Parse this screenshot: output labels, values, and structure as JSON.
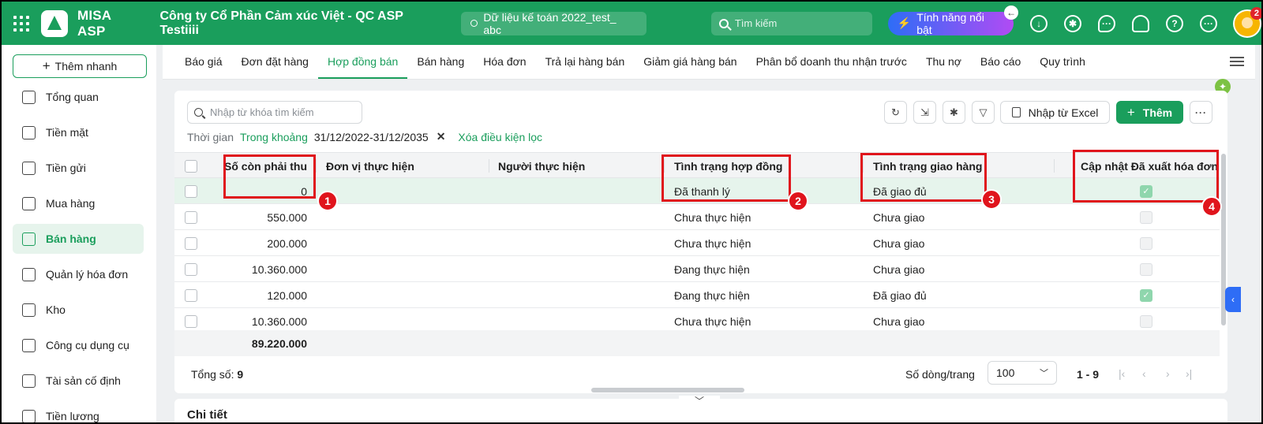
{
  "app": {
    "brand": "MISA ASP",
    "company": "Công ty Cổ Phần Cảm xúc Việt - QC ASP Testiiii",
    "database": "Dữ liệu kế toán 2022_test_ abc",
    "search_placeholder": "Tìm kiếm",
    "feature_label": "Tính năng nổi bật",
    "notification_count": "2",
    "top_icons": [
      "download-icon",
      "gear-icon",
      "chat-icon",
      "bell-icon",
      "help-icon",
      "more-horizontal-icon"
    ]
  },
  "sidebar": {
    "quick_add": "Thêm nhanh",
    "items": [
      {
        "label": "Tổng quan",
        "icon": "dashboard-icon"
      },
      {
        "label": "Tiền mặt",
        "icon": "cash-icon"
      },
      {
        "label": "Tiền gửi",
        "icon": "bank-icon"
      },
      {
        "label": "Mua hàng",
        "icon": "shopping-bag-icon"
      },
      {
        "label": "Bán hàng",
        "icon": "cart-icon",
        "active": true
      },
      {
        "label": "Quản lý hóa đơn",
        "icon": "invoice-icon"
      },
      {
        "label": "Kho",
        "icon": "warehouse-icon"
      },
      {
        "label": "Công cụ dụng cụ",
        "icon": "tools-icon"
      },
      {
        "label": "Tài sản cố định",
        "icon": "truck-icon"
      },
      {
        "label": "Tiền lương",
        "icon": "salary-icon"
      }
    ]
  },
  "tabs": [
    "Báo giá",
    "Đơn đặt hàng",
    "Hợp đồng bán",
    "Bán hàng",
    "Hóa đơn",
    "Trả lại hàng bán",
    "Giảm giá hàng bán",
    "Phân bổ doanh thu nhận trước",
    "Thu nợ",
    "Báo cáo",
    "Quy trình"
  ],
  "active_tab": "Hợp đồng bán",
  "toolbar": {
    "search_placeholder": "Nhập từ khóa tìm kiếm",
    "filter_label": "Thời gian",
    "filter_mode": "Trong khoảng",
    "filter_range": "31/12/2022-31/12/2035",
    "clear_filter": "Xóa điều kiện lọc",
    "import_excel": "Nhập từ Excel",
    "add": "Thêm"
  },
  "table": {
    "columns": [
      "Số còn phải thu",
      "Đơn vị thực hiện",
      "Người thực hiện",
      "Tình trạng hợp đồng",
      "Tình trạng giao hàng",
      "Cập nhật Đã xuất hóa đơn"
    ],
    "rows": [
      {
        "amount": "0",
        "unit": "",
        "person": "",
        "contract_status": "Đã thanh lý",
        "delivery_status": "Đã giao đủ",
        "invoiced": true
      },
      {
        "amount": "550.000",
        "unit": "",
        "person": "",
        "contract_status": "Chưa thực hiện",
        "delivery_status": "Chưa giao",
        "invoiced": false
      },
      {
        "amount": "200.000",
        "unit": "",
        "person": "",
        "contract_status": "Chưa thực hiện",
        "delivery_status": "Chưa giao",
        "invoiced": false
      },
      {
        "amount": "10.360.000",
        "unit": "",
        "person": "",
        "contract_status": "Đang thực hiện",
        "delivery_status": "Chưa giao",
        "invoiced": false
      },
      {
        "amount": "120.000",
        "unit": "",
        "person": "",
        "contract_status": "Đang thực hiện",
        "delivery_status": "Đã giao đủ",
        "invoiced": true
      },
      {
        "amount": "10.360.000",
        "unit": "",
        "person": "",
        "contract_status": "Chưa thực hiện",
        "delivery_status": "Chưa giao",
        "invoiced": false
      }
    ],
    "sum_amount": "89.220.000"
  },
  "footer": {
    "total_label": "Tổng số:",
    "total_value": "9",
    "per_page_label": "Số dòng/trang",
    "per_page_value": "100",
    "range": "1 - 9"
  },
  "detail_title": "Chi tiết",
  "annotations": [
    "1",
    "2",
    "3",
    "4"
  ],
  "colors": {
    "brand": "#1a9e5c",
    "annotation": "#e0141c"
  }
}
